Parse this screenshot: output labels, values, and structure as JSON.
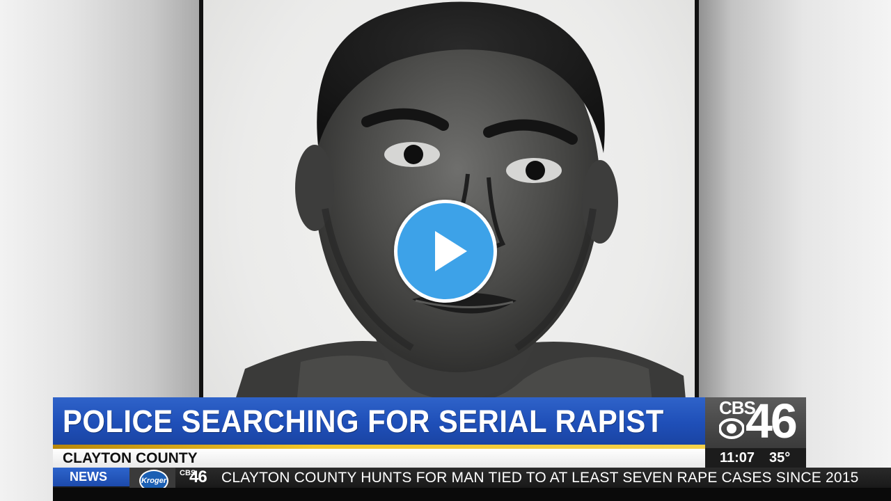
{
  "video": {
    "play_icon": "play-icon",
    "accent_color": "#3da2e8"
  },
  "lower_third": {
    "headline": "POLICE SEARCHING FOR SERIAL RAPIST",
    "location": "CLAYTON COUNTY",
    "bar_color": "#1f4fb8",
    "stripe_color": "#f3c628"
  },
  "station_logo": {
    "network": "CBS",
    "channel": "46",
    "icon": "cbs-eye-icon",
    "time": "11:07",
    "temperature": "35°"
  },
  "ticker": {
    "label": "NEWS",
    "sponsor": "Kroger",
    "mini_logo_network": "CBS",
    "mini_logo_channel": "46",
    "text": "CLAYTON COUNTY HUNTS FOR MAN TIED TO AT LEAST SEVEN RAPE CASES SINCE 2015"
  }
}
